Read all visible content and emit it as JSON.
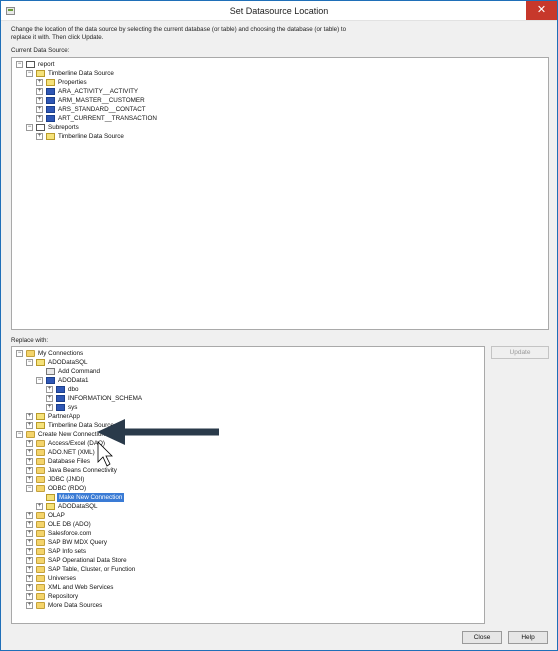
{
  "window": {
    "title": "Set Datasource Location",
    "close_glyph": "✕"
  },
  "instructions": "Change the location of the data source by selecting the current database (or table) and choosing the database (or table) to replace it with.  Then click Update.",
  "current_label": "Current Data Source:",
  "replace_label": "Replace with:",
  "current_tree": {
    "report": "report",
    "timberline": "Timberline Data Source",
    "properties": "Properties",
    "tables": [
      "ARA_ACTIVITY__ACTIVITY",
      "ARM_MASTER__CUSTOMER",
      "ARS_STANDARD__CONTACT",
      "ART_CURRENT__TRANSACTION"
    ],
    "subreports": "Subreports",
    "sub_timberline": "Timberline Data Source"
  },
  "replace_tree": {
    "my_connections": "My Connections",
    "adodatasql": "ADODataSQL",
    "add_command": "Add Command",
    "adodata1": "ADOData1",
    "schemas": [
      "dbo",
      "INFORMATION_SCHEMA",
      "sys"
    ],
    "partnerapp": "PartnerApp",
    "timberline": "Timberline Data Source",
    "create_new": "Create New Connection",
    "access_excel": "Access/Excel (DAO)",
    "ado_net": "ADO.NET (XML)",
    "database_files": "Database Files",
    "java_beans": "Java Beans Connectivity",
    "jdbc": "JDBC (JNDI)",
    "odbc": "ODBC (RDO)",
    "make_new": "Make New Connection",
    "adodatasql2": "ADODataSQL",
    "rest": [
      "OLAP",
      "OLE DB (ADO)",
      "Salesforce.com",
      "SAP BW MDX Query",
      "SAP Info sets",
      "SAP Operational Data Store",
      "SAP Table, Cluster, or Function",
      "Universes",
      "XML and Web Services",
      "Repository",
      "More Data Sources"
    ]
  },
  "buttons": {
    "update": "Update",
    "close": "Close",
    "help": "Help"
  },
  "colors": {
    "title_close": "#c7382b",
    "selection": "#3a7bd5",
    "arrow": "#2a3a4a"
  }
}
